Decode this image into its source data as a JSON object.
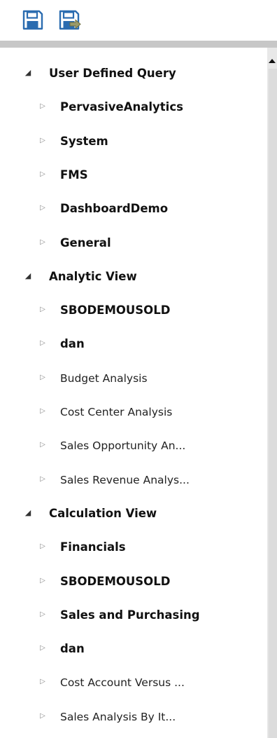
{
  "toolbar": {
    "buttons": [
      {
        "icon": "save-icon"
      },
      {
        "icon": "save-as-icon"
      }
    ],
    "icon_color": "#2b6cb0"
  },
  "tree": {
    "expanded_arrow": "◢",
    "collapsed_arrow": "▷",
    "sections": [
      {
        "label": "User Defined Query",
        "expanded": true,
        "children": [
          {
            "label": "PervasiveAnalytics",
            "bold": true
          },
          {
            "label": "System",
            "bold": true
          },
          {
            "label": "FMS",
            "bold": true
          },
          {
            "label": "DashboardDemo",
            "bold": true
          },
          {
            "label": "General",
            "bold": true
          }
        ]
      },
      {
        "label": "Analytic View",
        "expanded": true,
        "children": [
          {
            "label": "SBODEMOUSOLD",
            "bold": true
          },
          {
            "label": "dan",
            "bold": true
          },
          {
            "label": "Budget Analysis",
            "bold": false
          },
          {
            "label": "Cost Center Analysis",
            "bold": false
          },
          {
            "label": "Sales Opportunity An...",
            "bold": false
          },
          {
            "label": "Sales Revenue Analys...",
            "bold": false
          }
        ]
      },
      {
        "label": "Calculation View",
        "expanded": true,
        "children": [
          {
            "label": "Financials",
            "bold": true
          },
          {
            "label": "SBODEMOUSOLD",
            "bold": true
          },
          {
            "label": "Sales and Purchasing",
            "bold": true
          },
          {
            "label": "dan",
            "bold": true
          },
          {
            "label": "Cost Account Versus ...",
            "bold": false
          },
          {
            "label": "Sales Analysis By It...",
            "bold": false
          }
        ]
      }
    ]
  }
}
